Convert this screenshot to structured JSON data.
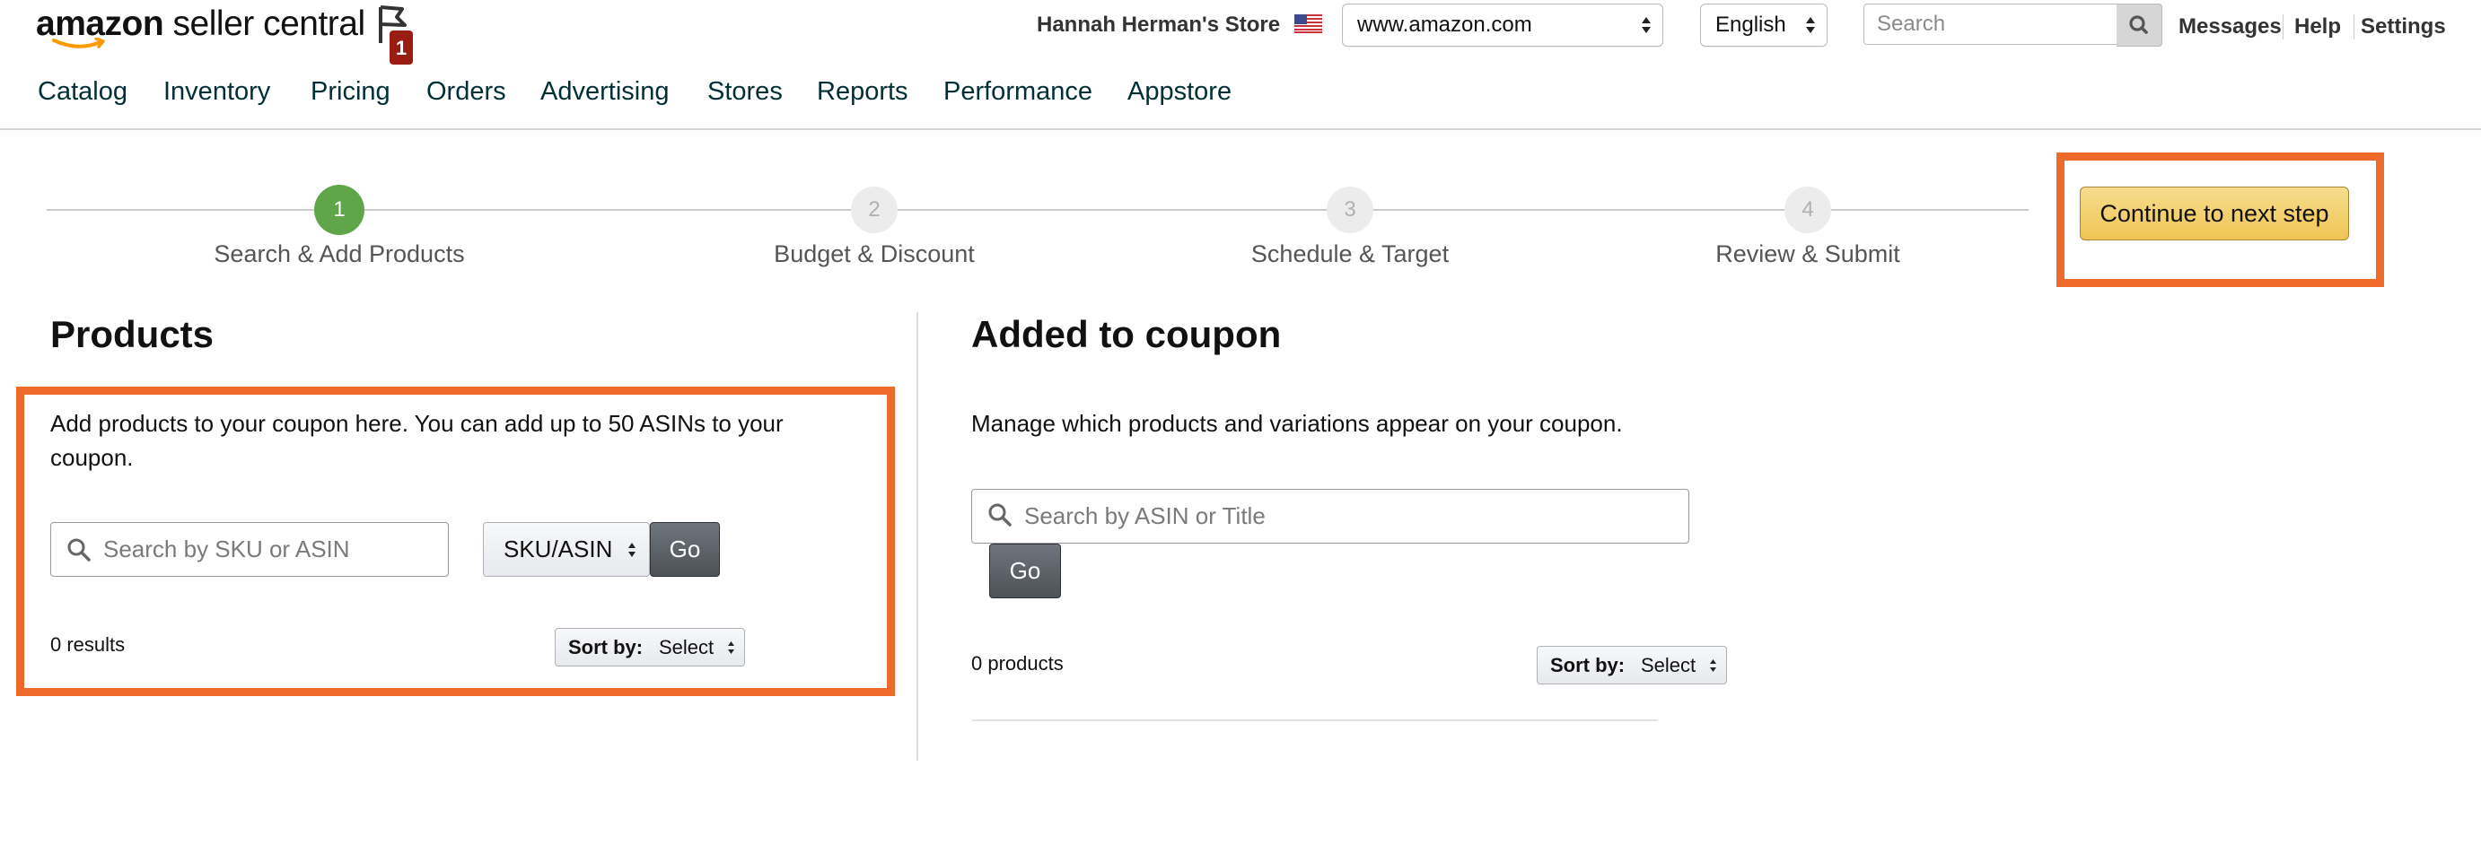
{
  "header": {
    "logo": {
      "brand": "amazon",
      "product": "seller central"
    },
    "notification_count": "1",
    "store_name": "Hannah Herman's Store",
    "marketplace": {
      "selected": "www.amazon.com"
    },
    "language": {
      "selected": "English"
    },
    "search": {
      "placeholder": "Search"
    },
    "links": {
      "messages": "Messages",
      "help": "Help",
      "settings": "Settings"
    }
  },
  "nav": {
    "items": [
      "Catalog",
      "Inventory",
      "Pricing",
      "Orders",
      "Advertising",
      "Stores",
      "Reports",
      "Performance",
      "Appstore"
    ]
  },
  "stepper": {
    "steps": [
      {
        "number": "1",
        "label": "Search & Add Products",
        "state": "active"
      },
      {
        "number": "2",
        "label": "Budget & Discount",
        "state": "todo"
      },
      {
        "number": "3",
        "label": "Schedule & Target",
        "state": "todo"
      },
      {
        "number": "4",
        "label": "Review & Submit",
        "state": "todo"
      }
    ],
    "continue_label": "Continue to next step"
  },
  "products": {
    "title": "Products",
    "description": "Add products to your coupon here. You can add up to 50 ASINs to your coupon.",
    "search": {
      "placeholder": "Search by SKU or ASIN"
    },
    "search_type": "SKU/ASIN",
    "go_label": "Go",
    "results": "0 results",
    "sort": {
      "label": "Sort by:",
      "value": "Select"
    }
  },
  "added": {
    "title": "Added to coupon",
    "description": "Manage which products and variations appear on your coupon.",
    "search": {
      "placeholder": "Search by ASIN or Title"
    },
    "go_label": "Go",
    "count": "0 products",
    "sort": {
      "label": "Sort by:",
      "value": "Select"
    }
  },
  "colors": {
    "highlight": "#ee6a2b",
    "step_active": "#61a54b",
    "primary_button": "#f0c14b",
    "nav_text": "#002f36",
    "badge": "#9b1c12"
  },
  "icons": [
    "flag-icon",
    "us-flag-icon",
    "search-icon",
    "magnifier-icon",
    "select-arrows-icon"
  ]
}
